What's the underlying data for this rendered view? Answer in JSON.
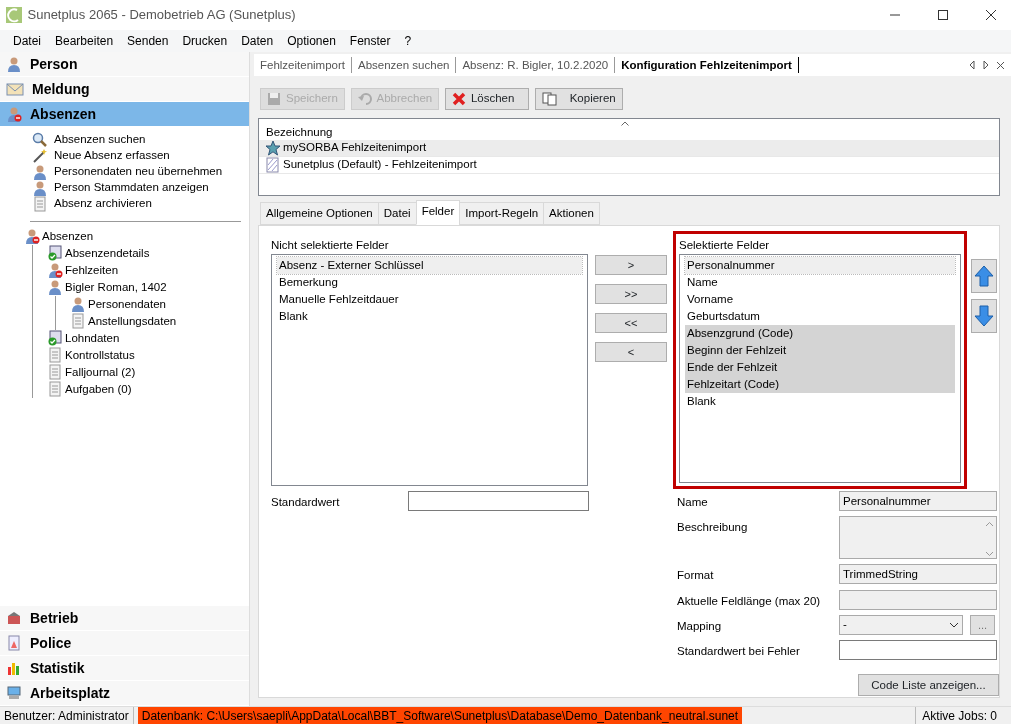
{
  "window": {
    "title": "Sunetplus 2065 - Demobetrieb AG (Sunetplus)"
  },
  "menu": [
    "Datei",
    "Bearbeiten",
    "Senden",
    "Drucken",
    "Daten",
    "Optionen",
    "Fenster",
    "?"
  ],
  "sidebar": {
    "sections_top": [
      {
        "label": "Person",
        "selected": false
      },
      {
        "label": "Meldung",
        "selected": false
      },
      {
        "label": "Absenzen",
        "selected": true
      }
    ],
    "actions": [
      "Absenzen suchen",
      "Neue Absenz erfassen",
      "Personendaten neu übernehmen",
      "Person Stammdaten anzeigen",
      "Absenz archivieren"
    ],
    "tree": [
      {
        "label": "Absenzen",
        "children": [
          {
            "label": "Absenzendetails"
          },
          {
            "label": "Fehlzeiten"
          },
          {
            "label": "Bigler Roman, 1402",
            "children": [
              {
                "label": "Personendaten"
              },
              {
                "label": "Anstellungsdaten"
              }
            ]
          },
          {
            "label": "Lohndaten"
          },
          {
            "label": "Kontrollstatus"
          },
          {
            "label": "Falljournal (2)"
          },
          {
            "label": "Aufgaben (0)"
          }
        ]
      }
    ],
    "sections_bottom": [
      {
        "label": "Betrieb",
        "selected": false
      },
      {
        "label": "Police",
        "selected": false
      },
      {
        "label": "Statistik",
        "selected": false
      },
      {
        "label": "Arbeitsplatz",
        "selected": false
      }
    ]
  },
  "doc_tabs": [
    {
      "label": "Fehlzeitenimport",
      "selected": false
    },
    {
      "label": "Absenzen suchen",
      "selected": false
    },
    {
      "label": "Absenz: R. Bigler, 10.2.2020",
      "selected": false
    },
    {
      "label": "Konfiguration Fehlzeitenimport",
      "selected": true
    }
  ],
  "toolbar": [
    {
      "label": "Speichern",
      "disabled": true
    },
    {
      "label": "Abbrechen",
      "disabled": true
    },
    {
      "label": "Löschen",
      "disabled": false
    },
    {
      "label": "Kopieren",
      "disabled": false
    }
  ],
  "grid": {
    "column": "Bezeichnung",
    "rows": [
      {
        "label": "mySORBA Fehlzeitenimport",
        "selected": true
      },
      {
        "label": "Sunetplus (Default) - Fehlzeitenimport",
        "selected": false
      }
    ]
  },
  "tabs": [
    {
      "label": "Allgemeine Optionen",
      "selected": false
    },
    {
      "label": "Datei",
      "selected": false
    },
    {
      "label": "Felder",
      "selected": true
    },
    {
      "label": "Import-Regeln",
      "selected": false
    },
    {
      "label": "Aktionen",
      "selected": false
    }
  ],
  "unselected_fields": {
    "label": "Nicht selektierte Felder",
    "items": [
      {
        "label": "Absenz - Externer Schlüssel",
        "selected": false,
        "focused": true
      },
      {
        "label": "Bemerkung",
        "selected": false,
        "focused": false
      },
      {
        "label": "Manuelle Fehlzeitdauer",
        "selected": false,
        "focused": false
      },
      {
        "label": "Blank",
        "selected": false,
        "focused": false
      }
    ]
  },
  "move_buttons": [
    ">",
    ">>",
    "<<",
    "<"
  ],
  "selected_fields": {
    "label": "Selektierte Felder",
    "items": [
      {
        "label": "Personalnummer",
        "selected": false,
        "focused": true
      },
      {
        "label": "Name",
        "selected": false,
        "focused": false
      },
      {
        "label": "Vorname",
        "selected": false,
        "focused": false
      },
      {
        "label": "Geburtsdatum",
        "selected": false,
        "focused": false
      },
      {
        "label": "Absenzgrund (Code)",
        "selected": true,
        "focused": false
      },
      {
        "label": "Beginn der Fehlzeit",
        "selected": true,
        "focused": false
      },
      {
        "label": "Ende der Fehlzeit",
        "selected": true,
        "focused": false
      },
      {
        "label": "Fehlzeitart (Code)",
        "selected": true,
        "focused": false
      },
      {
        "label": "Blank",
        "selected": false,
        "focused": false
      }
    ]
  },
  "default_value": {
    "label": "Standardwert"
  },
  "details": [
    {
      "kind": "readonly",
      "label": "Name",
      "value": "Personalnummer"
    },
    {
      "kind": "memo",
      "label": "Beschreibung"
    },
    {
      "kind": "readonly",
      "label": "Format",
      "value": "TrimmedString"
    },
    {
      "kind": "readonly",
      "label": "Aktuelle Feldlänge (max 20)"
    },
    {
      "kind": "select",
      "label": "Mapping",
      "value": "-",
      "button": "..."
    },
    {
      "kind": "input",
      "label": "Standardwert bei Fehler"
    }
  ],
  "code_list_button": "Code Liste anzeigen...",
  "status_bar": {
    "user": "Benutzer: Administrator",
    "database": "Datenbank: C:\\Users\\saepli\\AppData\\Local\\BBT_Software\\Sunetplus\\Database\\Demo_Datenbank_neutral.sunet",
    "jobs": "Aktive Jobs: 0"
  }
}
